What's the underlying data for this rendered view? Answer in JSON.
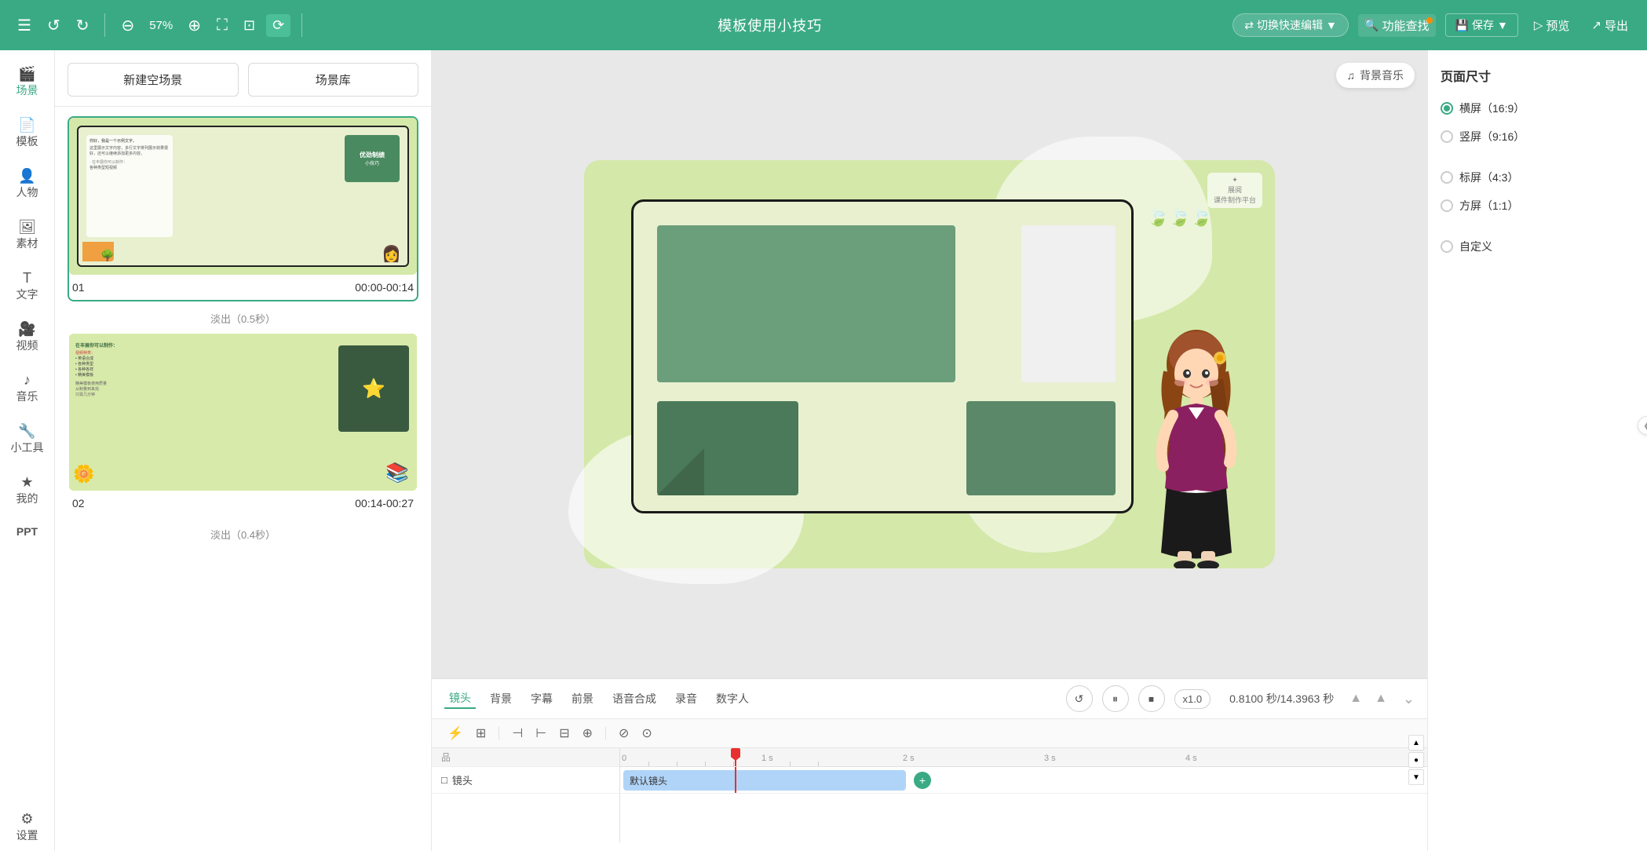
{
  "toolbar": {
    "menu_icon": "☰",
    "undo_icon": "↺",
    "redo_icon": "↻",
    "zoom_out_icon": "⊖",
    "zoom_level": "57%",
    "zoom_in_icon": "⊕",
    "fullscreen_icon": "⛶",
    "fit_icon": "⊡",
    "loop_icon": "⟳",
    "title": "模板使用小技巧",
    "switch_label": "切换快速编辑",
    "search_label": "功能查找",
    "save_label": "保存",
    "preview_label": "预览",
    "export_label": "导出",
    "dropdown_arrow": "▼",
    "search_dot": true
  },
  "left_nav": {
    "items": [
      {
        "id": "scene",
        "label": "场景"
      },
      {
        "id": "template",
        "label": "模板"
      },
      {
        "id": "character",
        "label": "人物"
      },
      {
        "id": "material",
        "label": "素材"
      },
      {
        "id": "text",
        "label": "文字"
      },
      {
        "id": "video",
        "label": "视频"
      },
      {
        "id": "music",
        "label": "音乐"
      },
      {
        "id": "tool",
        "label": "小工具"
      },
      {
        "id": "mine",
        "label": "我的"
      },
      {
        "id": "ppt",
        "label": "PPT"
      },
      {
        "id": "settings",
        "label": "设置"
      }
    ]
  },
  "scenes_panel": {
    "new_scene_btn": "新建空场景",
    "scene_library_btn": "场景库",
    "collapse_arrow": "❮",
    "bg_music_btn": "背景音乐",
    "bg_music_icon": "♫",
    "scenes": [
      {
        "id": "01",
        "number": "01",
        "time_range": "00:00-00:14",
        "transition": "淡出（0.5秒）",
        "active": true
      },
      {
        "id": "02",
        "number": "02",
        "time_range": "00:14-00:27",
        "transition": "淡出（0.4秒）",
        "active": false
      }
    ]
  },
  "canvas": {
    "watermark_line1": "展阅",
    "watermark_line2": "课件制作平台",
    "watermark_icon": "✦"
  },
  "timeline": {
    "tabs": [
      {
        "id": "lens",
        "label": "镜头",
        "active": true
      },
      {
        "id": "bg",
        "label": "背景",
        "active": false
      },
      {
        "id": "subtitle",
        "label": "字幕",
        "active": false
      },
      {
        "id": "foreground",
        "label": "前景",
        "active": false
      },
      {
        "id": "voice",
        "label": "语音合成",
        "active": false
      },
      {
        "id": "record",
        "label": "录音",
        "active": false
      },
      {
        "id": "digital",
        "label": "数字人",
        "active": false
      }
    ],
    "controls": {
      "restart_icon": "↺",
      "pause_icon": "⏸",
      "stop_icon": "⏹",
      "speed": "x1.0",
      "current_time": "0.8100 秒/14.3963 秒",
      "volume_icon": "▲",
      "expand_icon": "⌄"
    },
    "ruler_marks": [
      "0",
      "1 s",
      "2 s",
      "3 s",
      "4 s"
    ],
    "playhead_position": "0.8100",
    "tracks": [
      {
        "id": "camera",
        "icon": "□",
        "label": "镜头"
      }
    ],
    "camera_clip": {
      "label": "默认镜头",
      "add_icon": "+"
    },
    "toolbar_icons": [
      "⚡",
      "⊞",
      "⊟",
      "⊕",
      "⊗",
      "≡",
      "≣",
      "⊘",
      "⊙"
    ]
  },
  "right_panel": {
    "title": "页面尺寸",
    "options": [
      {
        "id": "landscape",
        "label": "横屏（16:9）",
        "checked": true
      },
      {
        "id": "portrait",
        "label": "竖屏（9:16）",
        "checked": false
      },
      {
        "id": "standard",
        "label": "标屏（4:3）",
        "checked": false
      },
      {
        "id": "square",
        "label": "方屏（1:1）",
        "checked": false
      },
      {
        "id": "custom",
        "label": "自定义",
        "checked": false
      }
    ]
  }
}
